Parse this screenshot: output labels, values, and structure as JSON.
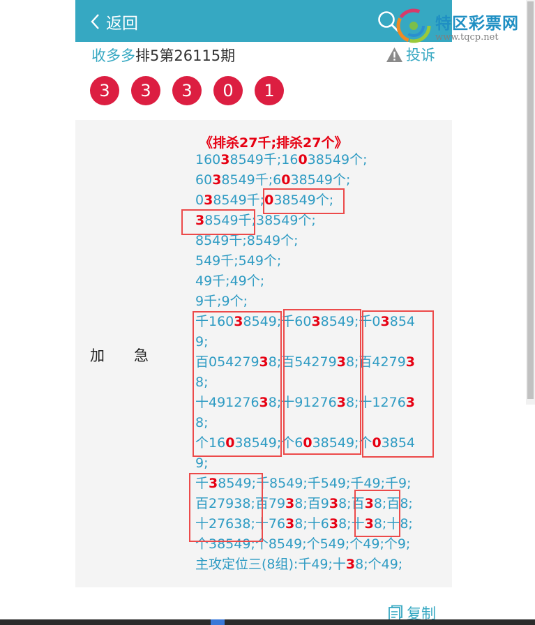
{
  "header": {
    "back_label": "返回"
  },
  "logo": {
    "text": "特区彩票网",
    "url": "www.tqcp.net"
  },
  "issue": {
    "prefix": "收多多",
    "title": "排5第26115期"
  },
  "complaint_label": "投诉",
  "balls": [
    "3",
    "3",
    "3",
    "0",
    "1"
  ],
  "ball_color": "#dc1e41",
  "accent_color": "#36a8c2",
  "highlight_color": "#e60012",
  "row_label": "加　　急",
  "content": {
    "heading": "《排杀27千;排杀27个》",
    "lines": [
      [
        {
          "t": "160"
        },
        {
          "t": "3",
          "r": true
        },
        {
          "t": "8549千;16"
        },
        {
          "t": "0",
          "r": true
        },
        {
          "t": "38549个;"
        }
      ],
      [
        {
          "t": "60"
        },
        {
          "t": "3",
          "r": true
        },
        {
          "t": "8549千;6"
        },
        {
          "t": "0",
          "r": true
        },
        {
          "t": "38549个;"
        }
      ],
      [
        {
          "t": "0"
        },
        {
          "t": "3",
          "r": true
        },
        {
          "t": "8549千;"
        },
        {
          "t": "0",
          "r": true
        },
        {
          "t": "38549个;"
        }
      ],
      [
        {
          "t": "3",
          "r": true
        },
        {
          "t": "8549千;38549个;"
        }
      ],
      [
        {
          "t": "8549千;8549个;"
        }
      ],
      [
        {
          "t": "549千;549个;"
        }
      ],
      [
        {
          "t": "49千;49个;"
        }
      ],
      [
        {
          "t": "9千;9个;"
        }
      ],
      [
        {
          "t": "千160"
        },
        {
          "t": "3",
          "r": true
        },
        {
          "t": "8549;千60"
        },
        {
          "t": "3",
          "r": true
        },
        {
          "t": "8549;千0"
        },
        {
          "t": "3",
          "r": true
        },
        {
          "t": "854"
        }
      ],
      [
        {
          "t": "9;"
        }
      ],
      [
        {
          "t": "百054279"
        },
        {
          "t": "3",
          "r": true
        },
        {
          "t": "8;百54279"
        },
        {
          "t": "3",
          "r": true
        },
        {
          "t": "8;百4279"
        },
        {
          "t": "3",
          "r": true
        }
      ],
      [
        {
          "t": "8;"
        }
      ],
      [
        {
          "t": "十491276"
        },
        {
          "t": "3",
          "r": true
        },
        {
          "t": "8;十91276"
        },
        {
          "t": "3",
          "r": true
        },
        {
          "t": "8;十1276"
        },
        {
          "t": "3",
          "r": true
        }
      ],
      [
        {
          "t": "8;"
        }
      ],
      [
        {
          "t": "个16"
        },
        {
          "t": "0",
          "r": true
        },
        {
          "t": "38549;个6"
        },
        {
          "t": "0",
          "r": true
        },
        {
          "t": "38549;个"
        },
        {
          "t": "0",
          "r": true
        },
        {
          "t": "3854"
        }
      ],
      [
        {
          "t": "9;"
        }
      ],
      [
        {
          "t": "千"
        },
        {
          "t": "3",
          "r": true
        },
        {
          "t": "8549;千8549;千549;千49;千9;"
        }
      ],
      [
        {
          "t": "百2793"
        },
        {
          "t": "8;百79"
        },
        {
          "t": "3",
          "r": true
        },
        {
          "t": "8;百9"
        },
        {
          "t": "3",
          "r": true
        },
        {
          "t": "8;百"
        },
        {
          "t": "3",
          "r": true
        },
        {
          "t": "8;百8;"
        }
      ],
      [
        {
          "t": "十2763"
        },
        {
          "t": "8;十76"
        },
        {
          "t": "3",
          "r": true
        },
        {
          "t": "8;十6"
        },
        {
          "t": "3",
          "r": true
        },
        {
          "t": "8;十"
        },
        {
          "t": "3",
          "r": true
        },
        {
          "t": "8;十8;"
        }
      ],
      [
        {
          "t": "个38549;个8549;个549;个49;个9;"
        }
      ],
      [
        {
          "t": "主攻定位三(8组):千49;十"
        },
        {
          "t": "3",
          "r": true
        },
        {
          "t": "8;个49;"
        }
      ]
    ]
  },
  "copy_label": "复制"
}
